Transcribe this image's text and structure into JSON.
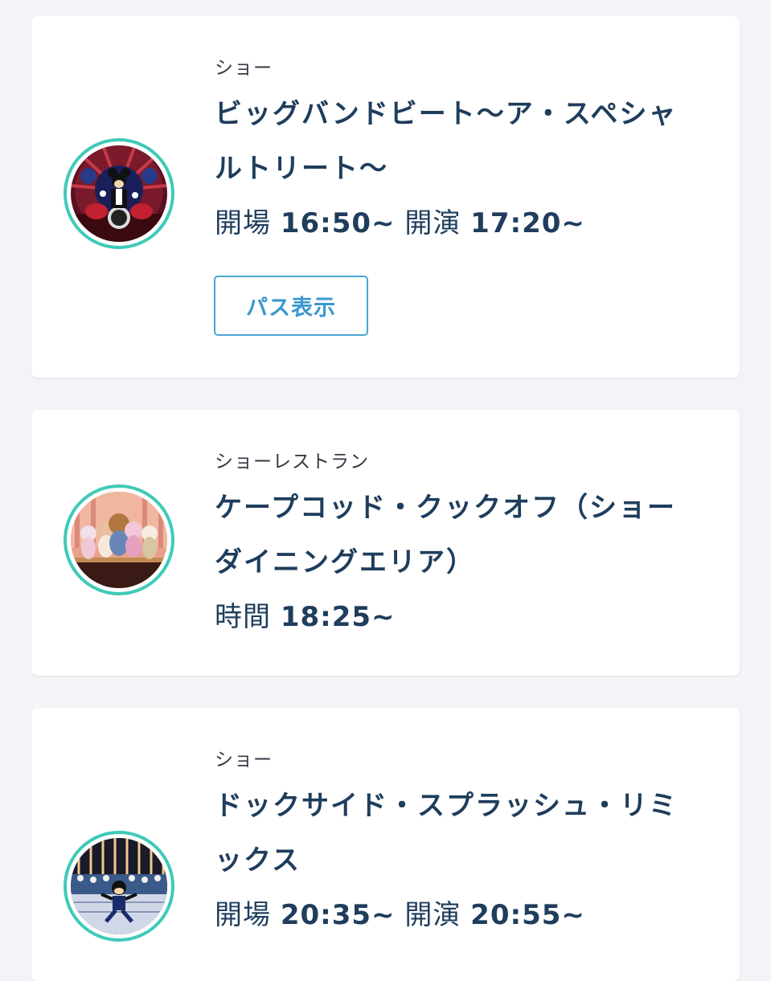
{
  "cards": [
    {
      "category": "ショー",
      "title_line1": "ビッグバンドビート〜ア・スペシャ",
      "title_line2": "ルトリート〜",
      "time_label_1": "開場",
      "time_value_1": "16:50~",
      "time_label_2": "開演",
      "time_value_2": "17:20~",
      "button_label": "パス表示",
      "image_icon": "big-band-beat-thumbnail"
    },
    {
      "category": "ショーレストラン",
      "title_line1": "ケープコッド・クックオフ（ショー",
      "title_line2": "ダイニングエリア）",
      "time_label_1": "時間",
      "time_value_1": "18:25~",
      "image_icon": "cape-cod-cook-off-thumbnail"
    },
    {
      "category": "ショー",
      "title_line1": "ドックサイド・スプラッシュ・リミ",
      "title_line2": "ックス",
      "time_label_1": "開場",
      "time_value_1": "20:35~",
      "time_label_2": "開演",
      "time_value_2": "20:55~",
      "image_icon": "dockside-splash-remix-thumbnail"
    }
  ],
  "colors": {
    "accent_ring": "#3fcab8",
    "title_text": "#1f3d5c",
    "button_border": "#4aa6d6",
    "background": "#f2f4f7"
  }
}
